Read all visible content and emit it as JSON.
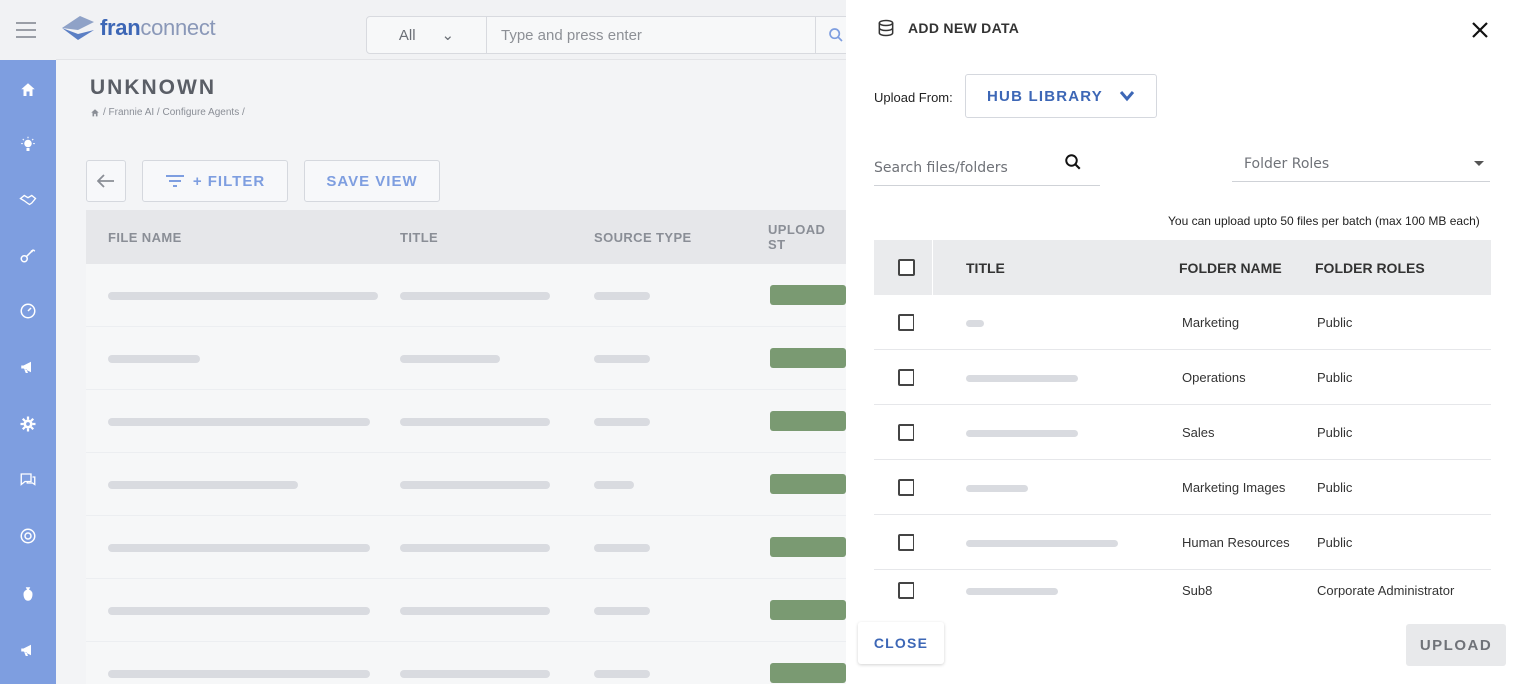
{
  "topbar": {
    "logo_bold": "fran",
    "logo_light": "connect",
    "search_category": "All",
    "search_placeholder": "Type and press enter"
  },
  "page": {
    "title": "UNKNOWN",
    "breadcrumb": "/ Frannie AI / Configure Agents /",
    "toolbar": {
      "filter_label": "+ FILTER",
      "save_view_label": "SAVE VIEW"
    },
    "columns": [
      "FILE NAME",
      "TITLE",
      "SOURCE TYPE",
      "UPLOAD ST"
    ]
  },
  "rail_icons": [
    "home-icon",
    "lightbulb-icon",
    "handshake-icon",
    "key-icon",
    "gauge-icon",
    "megaphone-icon",
    "settings-icon",
    "chat-icon",
    "support-icon",
    "money-bag-icon",
    "megaphone-icon"
  ],
  "panel": {
    "heading": "ADD NEW DATA",
    "upload_from_label": "Upload From:",
    "source": "HUB LIBRARY",
    "search_placeholder": "Search files/folders",
    "roles_placeholder": "Folder Roles",
    "limit_note": "You can upload upto 50 files per batch (max 100 MB each)",
    "columns": {
      "title": "TITLE",
      "folder_name": "FOLDER NAME",
      "folder_roles": "FOLDER ROLES"
    },
    "rows": [
      {
        "folder_name": "Marketing",
        "folder_roles": "Public"
      },
      {
        "folder_name": "Operations",
        "folder_roles": "Public"
      },
      {
        "folder_name": "Sales",
        "folder_roles": "Public"
      },
      {
        "folder_name": "Marketing Images",
        "folder_roles": "Public"
      },
      {
        "folder_name": "Human Resources",
        "folder_roles": "Public"
      },
      {
        "folder_name": "Sub8",
        "folder_roles": "Corporate Administrator"
      }
    ],
    "close_label": "CLOSE",
    "upload_label": "UPLOAD"
  },
  "colors": {
    "accent": "#3d67b6",
    "rail": "#7e9ee0"
  }
}
